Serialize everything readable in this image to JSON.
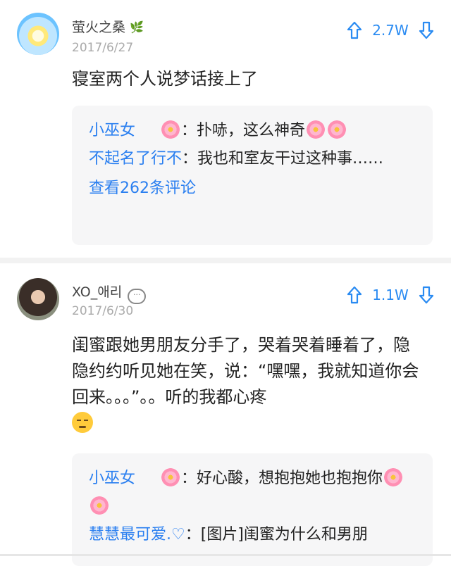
{
  "posts": [
    {
      "username": "萤火之桑",
      "badge_icon": "leaf-icon",
      "date": "2017/6/27",
      "votes": "2.7W",
      "content": "寝室两个人说梦话接上了",
      "comments": [
        {
          "name": "小巫女",
          "text": "：扑哧，这么神奇"
        },
        {
          "name": "不起名了行不",
          "text": "：我也和室友干过这种事……"
        }
      ],
      "more": "查看262条评论"
    },
    {
      "username": "XO_애리",
      "badge_icon": "speech-bubble-icon",
      "date": "2017/6/30",
      "votes": "1.1W",
      "content": "闺蜜跟她男朋友分手了，哭着哭着睡着了，隐隐约约听见她在笑，说：“嘿嘿，我就知道你会回来。。。”。。听的我都心疼",
      "comments": [
        {
          "name": "小巫女",
          "text": "：好心酸，想抱抱她也抱抱你"
        },
        {
          "name": "慧慧最可爱.♡",
          "text": "：[图片]闺蜜为什么和男朋"
        }
      ]
    }
  ],
  "colors": {
    "accent": "#2a8bf2",
    "name_blue": "#2a7ff0",
    "comment_bg": "#f6f6f7"
  }
}
